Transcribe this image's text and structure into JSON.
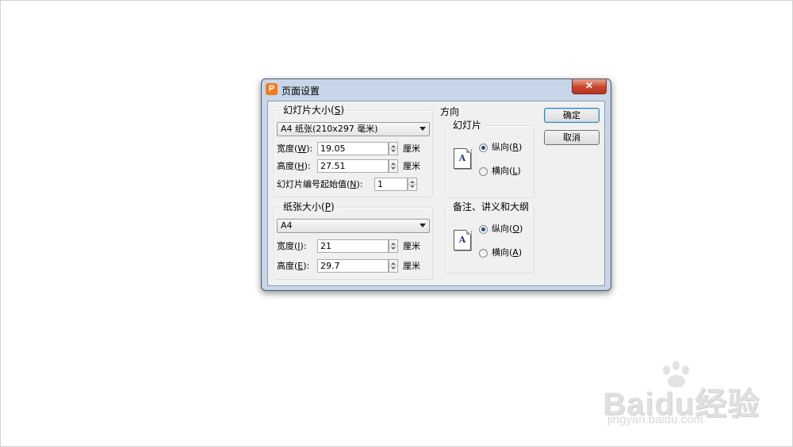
{
  "window": {
    "title": "页面设置",
    "app_icon": "P",
    "close_glyph": "✕"
  },
  "slide_size": {
    "group_title_text": "幻灯片大小",
    "group_title_key": "S",
    "selected": "A4 纸张(210x297 毫米)",
    "width_label": "宽度",
    "width_key": "W",
    "width_value": "19.05",
    "height_label": "高度",
    "height_key": "H",
    "height_value": "27.51",
    "unit": "厘米",
    "start_number_label": "幻灯片编号起始值",
    "start_number_key": "N",
    "start_number_value": "1"
  },
  "paper_size": {
    "group_title_text": "纸张大小",
    "group_title_key": "P",
    "selected": "A4",
    "width_label": "宽度",
    "width_key": "I",
    "width_value": "21",
    "height_label": "高度",
    "height_key": "E",
    "height_value": "29.7",
    "unit": "厘米"
  },
  "orientation": {
    "title": "方向",
    "slides": {
      "title": "幻灯片",
      "icon_letter": "A",
      "portrait_label": "纵向",
      "portrait_key": "R",
      "landscape_label": "横向",
      "landscape_key": "L",
      "selected": "portrait"
    },
    "notes": {
      "title": "备注、讲义和大纲",
      "icon_letter": "A",
      "portrait_label": "纵向",
      "portrait_key": "O",
      "landscape_label": "横向",
      "landscape_key": "A",
      "selected": "portrait"
    }
  },
  "buttons": {
    "ok": "确定",
    "cancel": "取消"
  },
  "watermark": {
    "brand": "Baidu经验",
    "url": "jingyan.baidu.com"
  }
}
